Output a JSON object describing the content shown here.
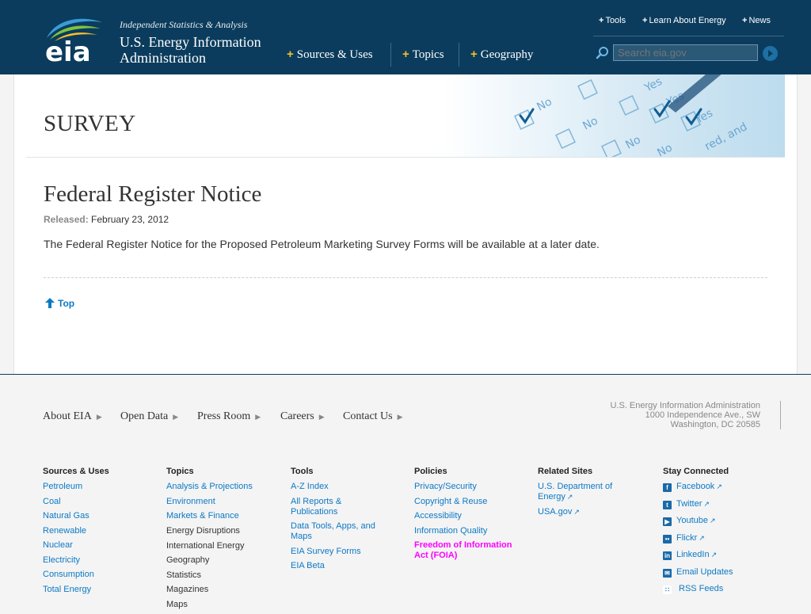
{
  "header": {
    "logo_text": "eia",
    "tagline": "Independent Statistics & Analysis",
    "org_line1": "U.S. Energy Information",
    "org_line2": "Administration",
    "util_links": [
      "Tools",
      "Learn About Energy",
      "News"
    ],
    "main_nav": [
      "Sources & Uses",
      "Topics",
      "Geography"
    ],
    "search_placeholder": "Search eia.gov"
  },
  "banner": {
    "title": "SURVEY",
    "graphic_words": [
      "No",
      "Yes",
      "No",
      "Yes",
      "No",
      "Yes",
      "No",
      "red, and"
    ]
  },
  "main": {
    "heading": "Federal Register Notice",
    "released_label": "Released:",
    "released_date": "February 23, 2012",
    "description": "The Federal Register Notice for the Proposed Petroleum Marketing Survey Forms will be available at a later date.",
    "top_link": "Top"
  },
  "footer": {
    "nav": [
      "About EIA",
      "Open Data",
      "Press Room",
      "Careers",
      "Contact Us"
    ],
    "address": [
      "U.S. Energy Information Administration",
      "1000 Independence Ave., SW",
      "Washington, DC 20585"
    ],
    "columns": [
      {
        "heading": "Sources & Uses",
        "items": [
          "Petroleum",
          "Coal",
          "Natural Gas",
          "Renewable",
          "Nuclear",
          "Electricity",
          "Consumption",
          "Total Energy"
        ]
      },
      {
        "heading": "Topics",
        "items": [
          "Analysis & Projections",
          "Environment",
          "Markets & Finance"
        ],
        "overlap_items": [
          "Energy Disruptions",
          "International Energy",
          "Geography",
          "Statistics",
          "Magazines",
          "Maps"
        ]
      },
      {
        "heading": "Tools",
        "items": [
          "A-Z Index",
          "All Reports & Publications",
          "Data Tools, Apps, and Maps",
          "EIA Survey Forms",
          "EIA Beta"
        ]
      },
      {
        "heading": "Policies",
        "items": [
          "Privacy/Security",
          "Copyright & Reuse",
          "Accessibility",
          "Information Quality"
        ],
        "overlap_items": [
          "Freedom of Information Act (FOIA)"
        ]
      },
      {
        "heading": "Related Sites",
        "items": [
          "U.S. Department of Energy",
          "USA.gov"
        ]
      },
      {
        "heading": "Stay Connected",
        "items": [
          "Facebook",
          "Twitter",
          "Youtube",
          "Flickr",
          "LinkedIn",
          "Email Updates",
          "RSS Feeds"
        ]
      }
    ]
  },
  "colors": {
    "header_bg": "#0b3c5d",
    "link": "#0d79c4",
    "accent_plus": "#f6c02b",
    "overlap_text": "#ff00ff"
  }
}
